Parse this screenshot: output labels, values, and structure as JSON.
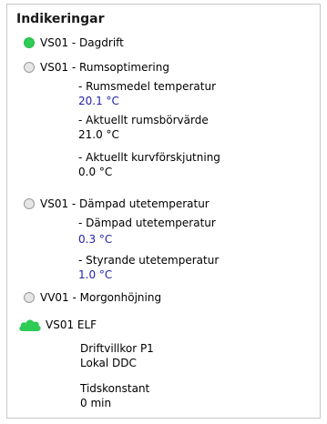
{
  "panel": {
    "title": "Indikeringar"
  },
  "items": [
    {
      "label": "VS01 - Dagdrift",
      "state": "on",
      "icon": "status-dot-green-icon"
    },
    {
      "label": "VS01 - Rumsoptimering",
      "state": "off",
      "icon": "status-dot-grey-icon",
      "details": [
        {
          "label": "- Rumsmedel temperatur",
          "value": "20.1 °C"
        },
        {
          "label": "- Aktuellt rumsbörvärde",
          "value": "21.0 °C"
        },
        {
          "label": "- Aktuellt kurvförskjutning",
          "value": "0.0 °C"
        }
      ]
    },
    {
      "label": "VS01 - Dämpad utetemperatur",
      "state": "off",
      "icon": "status-dot-grey-icon",
      "details": [
        {
          "label": "- Dämpad utetemperatur",
          "value": "0.3 °C"
        },
        {
          "label": "- Styrande utetemperatur",
          "value": "1.0 °C"
        }
      ]
    },
    {
      "label": "VV01 - Morgonhöjning",
      "state": "off",
      "icon": "status-dot-grey-icon"
    },
    {
      "label": "VS01 ELF",
      "state": "on",
      "icon": "cloud-icon",
      "details": [
        {
          "label": "Driftvillkor P1",
          "value": "Lokal DDC"
        },
        {
          "label": "Tidskonstant",
          "value": "0 min"
        }
      ]
    }
  ],
  "colors": {
    "active": "#2ecc55",
    "inactive": "#e6e6e6",
    "value_blue": "#2222aa"
  }
}
